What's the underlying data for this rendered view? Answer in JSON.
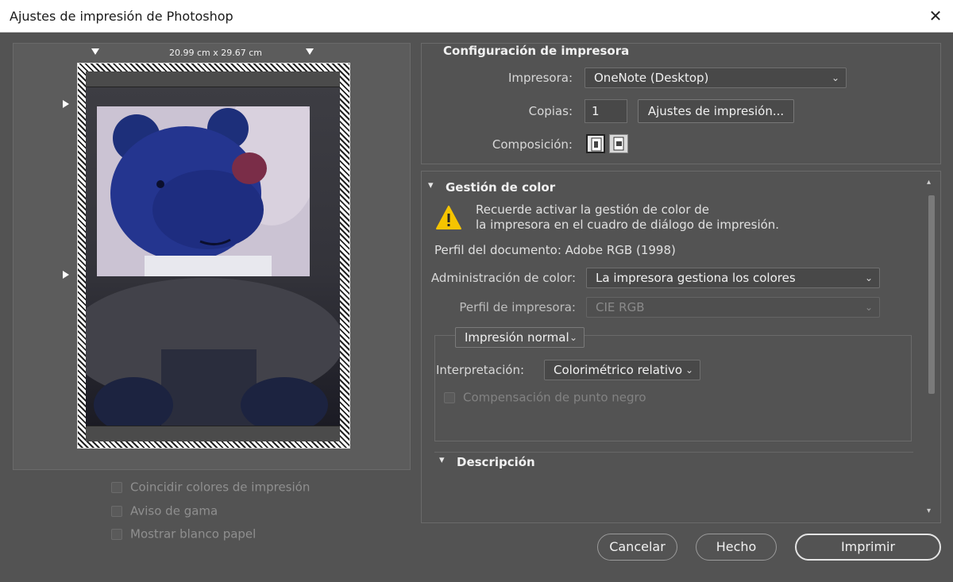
{
  "window": {
    "title": "Ajustes de impresión de Photoshop",
    "close_glyph": "✕"
  },
  "preview": {
    "dimensions": "20.99 cm x 29.67 cm",
    "checkboxes": [
      {
        "label": "Coincidir colores de impresión",
        "checked": false,
        "enabled": false
      },
      {
        "label": "Aviso de gama",
        "checked": false,
        "enabled": false
      },
      {
        "label": "Mostrar blanco papel",
        "checked": false,
        "enabled": false
      }
    ]
  },
  "printer_setup": {
    "title": "Configuración de impresora",
    "printer_label": "Impresora:",
    "printer_value": "OneNote (Desktop)",
    "copies_label": "Copias:",
    "copies_value": "1",
    "print_settings_button": "Ajustes de impresión...",
    "layout_label": "Composición:"
  },
  "color_management": {
    "title": "Gestión de color",
    "warning_line1": "Recuerde activar la gestión de color de",
    "warning_line2": "la impresora en el cuadro de diálogo de impresión.",
    "document_profile": "Perfil del documento: Adobe RGB (1998)",
    "color_handling_label": "Administración de color:",
    "color_handling_value": "La impresora gestiona los colores",
    "printer_profile_label": "Perfil de impresora:",
    "printer_profile_value": "CIE RGB",
    "print_mode_value": "Impresión normal",
    "rendering_intent_label": "Interpretación:",
    "rendering_intent_value": "Colorimétrico relativo",
    "black_point_label": "Compensación de punto negro"
  },
  "description": {
    "title": "Descripción"
  },
  "footer": {
    "cancel": "Cancelar",
    "done": "Hecho",
    "print": "Imprimir"
  },
  "colors": {
    "panel_bg": "#535353",
    "titlebar_bg": "#ffffff",
    "warning_yellow": "#f5c400"
  }
}
